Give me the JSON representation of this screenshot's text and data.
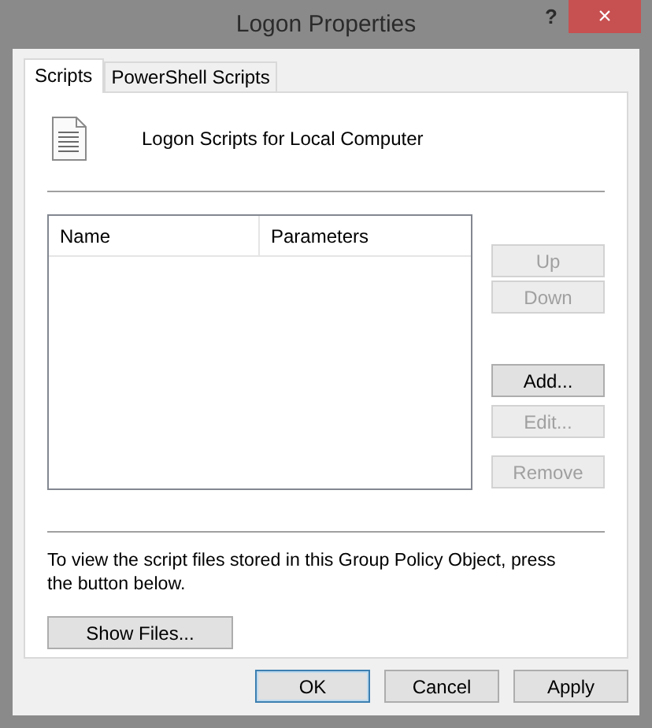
{
  "window": {
    "title": "Logon Properties",
    "help": "?",
    "close": "×"
  },
  "tabs": [
    {
      "label": "Scripts",
      "selected": true
    },
    {
      "label": "PowerShell Scripts",
      "selected": false
    }
  ],
  "heading": "Logon Scripts for Local Computer",
  "table": {
    "columns": [
      "Name",
      "Parameters"
    ]
  },
  "side_buttons": [
    {
      "label": "Up",
      "disabled": true
    },
    {
      "label": "Down",
      "disabled": true
    },
    {
      "label": "Add...",
      "disabled": false
    },
    {
      "label": "Edit...",
      "disabled": true
    },
    {
      "label": "Remove",
      "disabled": true
    }
  ],
  "info": "To view the script files stored in this Group Policy Object, press the button below.",
  "show_files": {
    "label": "Show Files...",
    "disabled": false
  },
  "buttons": [
    {
      "label": "OK",
      "default": true
    },
    {
      "label": "Cancel",
      "default": false
    },
    {
      "label": "Apply",
      "default": false
    }
  ]
}
